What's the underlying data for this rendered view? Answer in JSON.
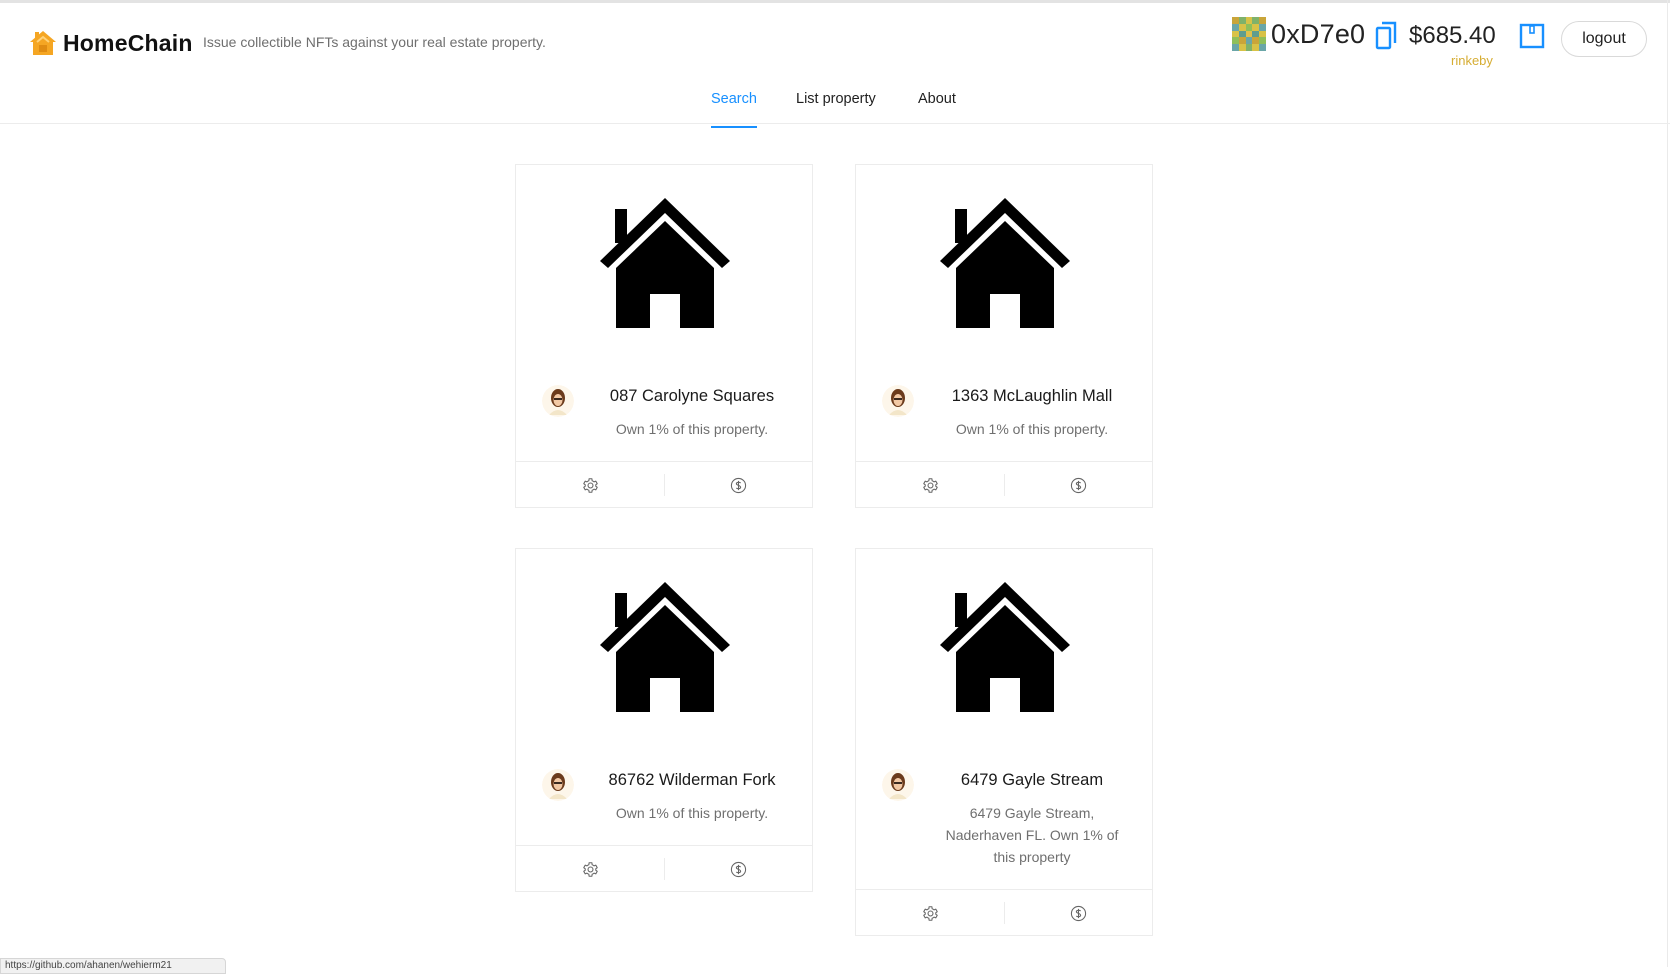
{
  "header": {
    "brand": "HomeChain",
    "tagline": "Issue collectible NFTs against your real estate property.",
    "address": "0xD7e0",
    "balance": "$685.40",
    "network": "rinkeby",
    "logout": "logout"
  },
  "nav": {
    "tabs": [
      {
        "label": "Search",
        "active": true
      },
      {
        "label": "List property",
        "active": false
      },
      {
        "label": "About",
        "active": false
      }
    ]
  },
  "cards": [
    {
      "title": "087 Carolyne Squares",
      "desc": "Own 1% of this property."
    },
    {
      "title": "1363 McLaughlin Mall",
      "desc": "Own 1% of this property."
    },
    {
      "title": "86762 Wilderman Fork",
      "desc": "Own 1% of this property."
    },
    {
      "title": "6479 Gayle Stream",
      "desc": "6479 Gayle Stream, Naderhaven FL. Own 1% of this property"
    }
  ],
  "icons": {
    "logo": "house-logo-icon",
    "copy": "copy-icon",
    "wallet": "wallet-icon",
    "settings": "gear-icon",
    "buy": "dollar-circle-icon"
  },
  "colors": {
    "accent": "#1890ff",
    "network": "#d6ad33",
    "logo": "#f5a623"
  },
  "status_bar": {
    "url": "https://github.com/ahanen/wehierm21"
  }
}
